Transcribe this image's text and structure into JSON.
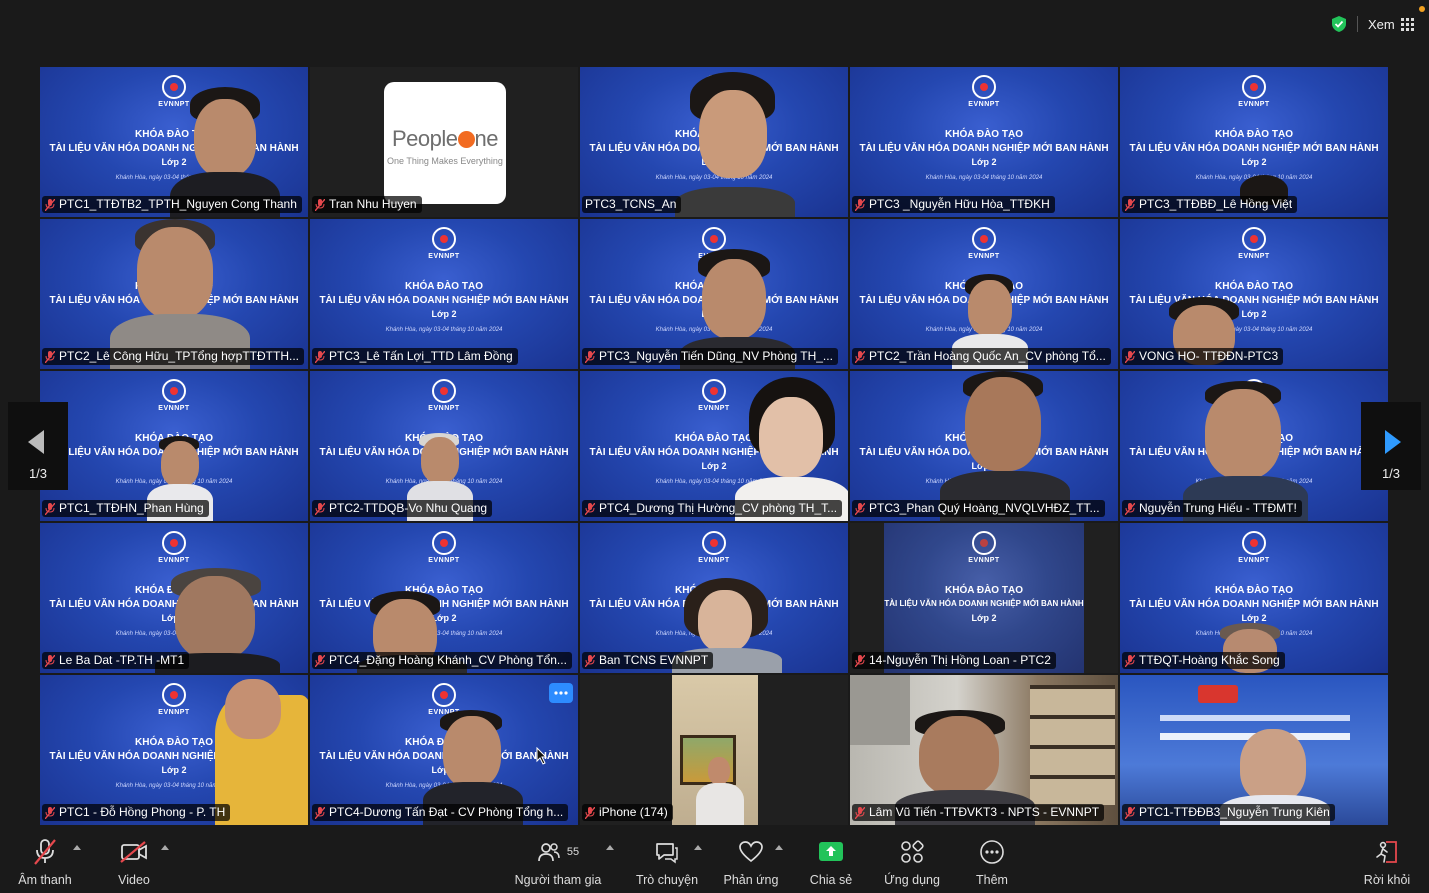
{
  "topbar": {
    "view_label": "Xem"
  },
  "pagination": {
    "left": "1/3",
    "right": "1/3"
  },
  "slide": {
    "org": "EVNNPT",
    "line1": "KHÓA ĐÀO TẠO",
    "line2": "TÀI LIỆU VĂN HÓA DOANH NGHIỆP MỚI BAN HÀNH",
    "line3": "Lớp 2",
    "line4": "Khánh Hòa, ngày 03-04 tháng 10 năm 2024"
  },
  "brand_card": {
    "part1": "People",
    "part2": "ne",
    "tagline": "One Thing Makes Everything"
  },
  "participants": [
    {
      "name": "PTC1_TTĐTB2_TPTH_Nguyen Cong Thanh"
    },
    {
      "name": "Tran Nhu Huyen"
    },
    {
      "name": "PTC3_TCNS_An"
    },
    {
      "name": "PTC3 _Nguyễn Hữu Hòa_TTĐKH"
    },
    {
      "name": "PTC3_TTĐBĐ_Lê Hồng Việt"
    },
    {
      "name": "PTC2_Lê Công Hữu_TPTổng hợpTTĐTTH..."
    },
    {
      "name": "PTC3_Lê Tấn Lợi_TTD Lâm Đồng"
    },
    {
      "name": "PTC3_Nguyễn Tiến Dũng_NV Phòng TH_..."
    },
    {
      "name": "PTC2_Trần Hoàng Quốc An_CV phòng Tổ..."
    },
    {
      "name": "VONG HO- TTĐĐN-PTC3"
    },
    {
      "name": "PTC1_TTĐHN_Phan Hùng"
    },
    {
      "name": "PTC2-TTDQB-Vo Nhu Quang"
    },
    {
      "name": "PTC4_Dương Thị Hường_CV phòng TH_T..."
    },
    {
      "name": "PTC3_Phan Quý Hoàng_NVQLVHĐZ_TT..."
    },
    {
      "name": "Nguyễn Trung Hiếu - TTĐMT!"
    },
    {
      "name": "Le Ba Dat -TP.TH -MT1"
    },
    {
      "name": "PTC4_Đặng Hoàng Khánh_CV Phòng Tổn..."
    },
    {
      "name": "Ban TCNS EVNNPT"
    },
    {
      "name": "14-Nguyễn Thị Hồng Loan - PTC2"
    },
    {
      "name": "TTĐQT-Hoàng Khắc Song"
    },
    {
      "name": "PTC1 - Đỗ Hồng Phong - P. TH"
    },
    {
      "name": "PTC4-Dương Tấn Đạt - CV Phòng Tổng h..."
    },
    {
      "name": "iPhone (174)"
    },
    {
      "name": "Lâm Vũ Tiến -TTĐVKT3 - NPTS - EVNNPT"
    },
    {
      "name": "PTC1-TTĐĐB3_Nguyễn Trung Kiên"
    }
  ],
  "toolbar": {
    "audio": "Âm thanh",
    "video": "Video",
    "participants": "Người tham gia",
    "participant_count": "55",
    "chat": "Trò chuyện",
    "react": "Phản ứng",
    "share": "Chia sẻ",
    "apps": "Ứng dụng",
    "more": "Thêm",
    "leave": "Rời khỏi"
  },
  "colors": {
    "active_speaker": "#2fd14a",
    "share_green": "#22c35a",
    "leave_red": "#e5484d",
    "accent_blue": "#2d8cff"
  }
}
